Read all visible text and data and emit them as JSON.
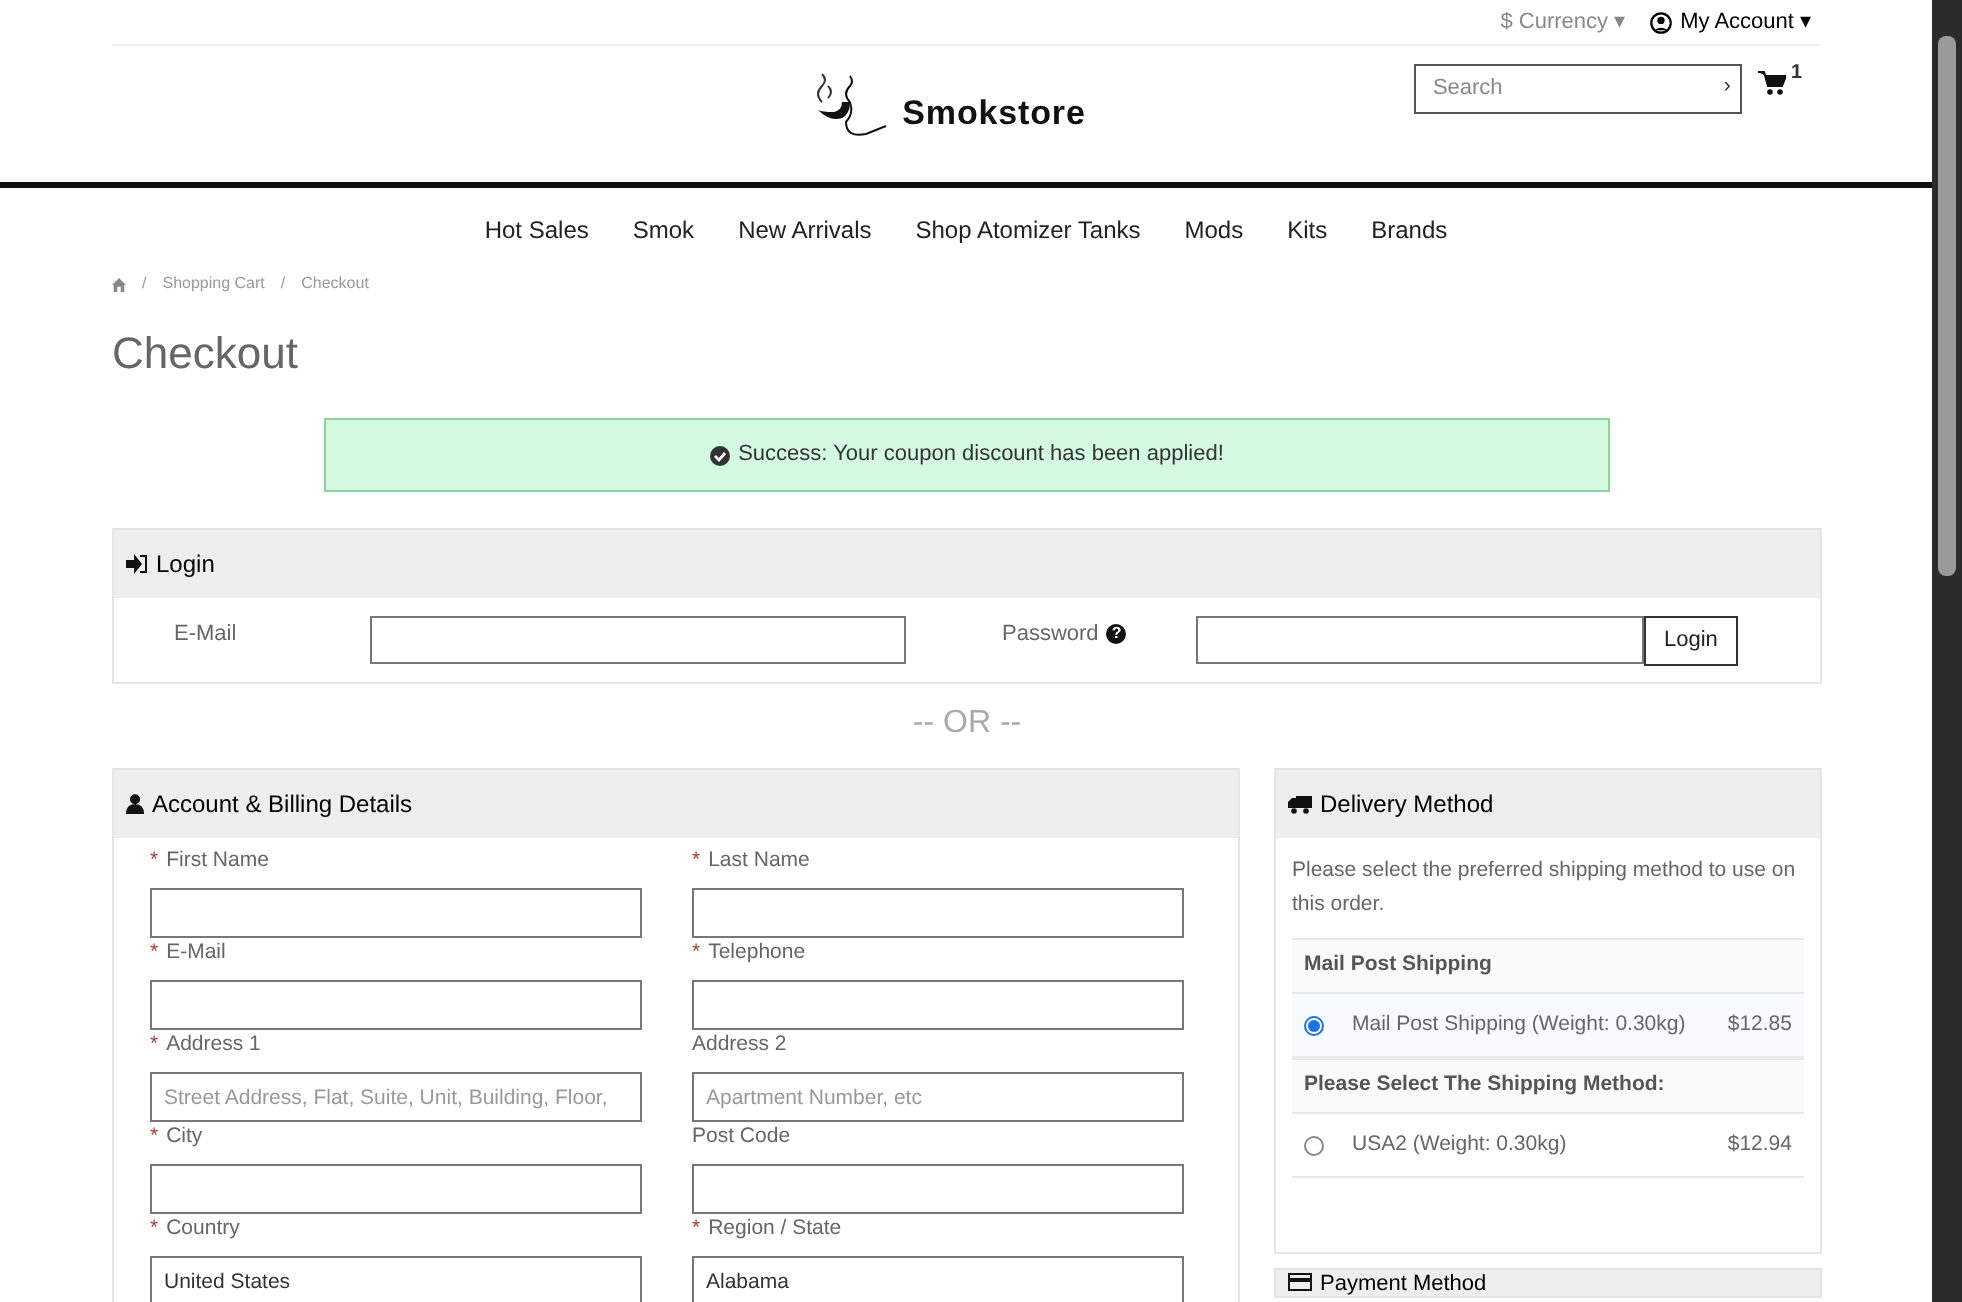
{
  "top_bar": {
    "currency": "$ Currency",
    "account": "My Account",
    "caret": "▾"
  },
  "header": {
    "logo": "Smokstore",
    "search": {
      "placeholder": "Search",
      "go": "›"
    },
    "cart_count": "1"
  },
  "nav": [
    "Hot Sales",
    "Smok",
    "New Arrivals",
    "Shop Atomizer Tanks",
    "Mods",
    "Kits",
    "Brands"
  ],
  "breadcrumb": [
    "Shopping Cart",
    "Checkout"
  ],
  "breadcrumb_separator": "/",
  "title": "Checkout",
  "alert": "Success: Your coupon discount has been applied!",
  "login": {
    "title": "Login",
    "email_label": "E-Mail",
    "password_label": "Password",
    "help_icon": "?",
    "button": "Login"
  },
  "separator": "-- OR --",
  "billing": {
    "title": "Account & Billing Details",
    "required_mark": "*",
    "fields": [
      {
        "label": "First Name",
        "required": true
      },
      {
        "label": "Last Name",
        "required": true
      },
      {
        "label": "E-Mail",
        "required": true
      },
      {
        "label": "Telephone",
        "required": true
      },
      {
        "label": "Address 1",
        "required": true,
        "placeholder": "Street Address, Flat, Suite, Unit, Building, Floor,"
      },
      {
        "label": "Address 2",
        "required": false,
        "placeholder": "Apartment Number, etc"
      },
      {
        "label": "City",
        "required": true
      },
      {
        "label": "Post Code",
        "required": false
      },
      {
        "label": "Country",
        "required": true,
        "value": "United States"
      },
      {
        "label": "Region / State",
        "required": true,
        "value": "Alabama"
      }
    ]
  },
  "delivery": {
    "title": "Delivery Method",
    "intro": "Please select the preferred shipping method to use on this order.",
    "groups": [
      {
        "heading": "Mail Post Shipping",
        "options": [
          {
            "label": "Mail Post Shipping (Weight: 0.30kg)",
            "price": "$12.85",
            "selected": true
          }
        ]
      },
      {
        "heading": "Please Select The Shipping Method:",
        "options": [
          {
            "label": "USA2 (Weight: 0.30kg)",
            "price": "$12.94",
            "selected": false
          }
        ]
      }
    ]
  },
  "payment": {
    "title": "Payment Method"
  }
}
